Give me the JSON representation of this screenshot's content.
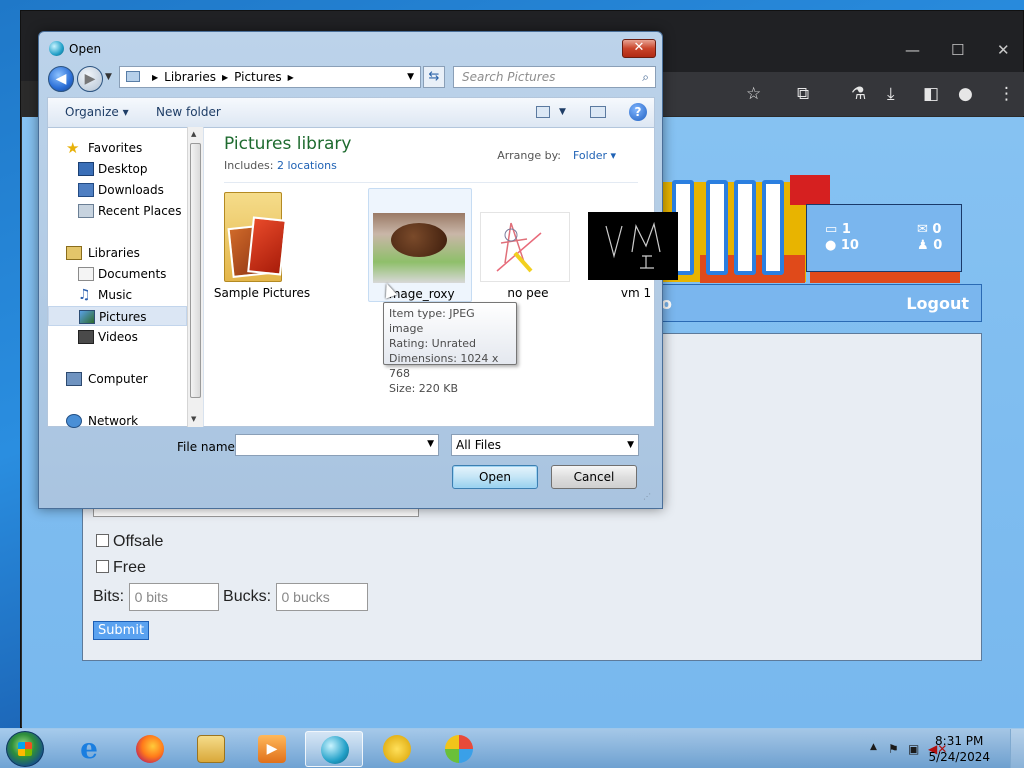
{
  "dialog": {
    "title": "Open",
    "close_glyph": "✕",
    "back_glyph": "◀",
    "forward_glyph": "▶",
    "path": [
      "Libraries",
      "Pictures"
    ],
    "search_placeholder": "Search Pictures",
    "organize_label": "Organize ▾",
    "new_folder_label": "New folder",
    "help_glyph": "?",
    "nav": {
      "favorites": "Favorites",
      "desktop": "Desktop",
      "downloads": "Downloads",
      "recent_places": "Recent Places",
      "libraries": "Libraries",
      "documents": "Documents",
      "music": "Music",
      "pictures": "Pictures",
      "videos": "Videos",
      "computer": "Computer",
      "network": "Network"
    },
    "library_title": "Pictures library",
    "includes_label": "Includes:",
    "includes_link": "2 locations",
    "arrange_label": "Arrange by:",
    "arrange_value": "Folder ▾",
    "items": [
      {
        "label": "Sample Pictures"
      },
      {
        "label": "image_roxy"
      },
      {
        "label": "no pee"
      },
      {
        "label": "vm 1"
      }
    ],
    "tooltip": {
      "type": "Item type: JPEG image",
      "rating": "Rating: Unrated",
      "dimensions": "Dimensions: 1024 x 768",
      "size": "Size: 220 KB"
    },
    "file_name_label": "File name:",
    "file_name_value": "",
    "file_type": "All Files",
    "open_label": "Open",
    "cancel_label": "Cancel"
  },
  "browser": {
    "minimize": "—",
    "maximize": "☐",
    "close": "✕",
    "stats": {
      "a": "1",
      "b": "10",
      "c": "0",
      "d": "0"
    },
    "nav_partial": "o",
    "logout_label": "Logout",
    "offsale_label": "Offsale",
    "free_label": "Free",
    "bits_label": "Bits:",
    "bits_placeholder": "0 bits",
    "bucks_label": "Bucks:",
    "bucks_placeholder": "0 bucks",
    "submit_label": "Submit"
  },
  "taskbar": {
    "time": "8:31 PM",
    "date": "5/24/2024"
  }
}
